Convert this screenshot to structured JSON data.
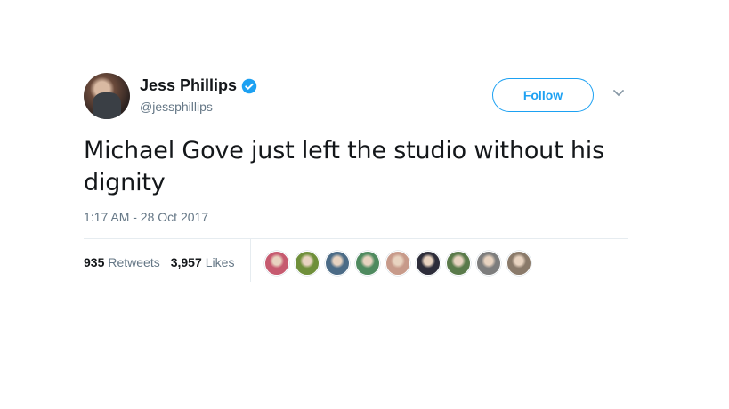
{
  "author": {
    "name": "Jess Phillips",
    "handle": "@jessphillips",
    "verified": true,
    "verified_color": "#1da1f2"
  },
  "follow_label": "Follow",
  "menu_icon": "chevron-down-icon",
  "tweet_text": "Michael Gove just left the studio without his dignity",
  "timestamp": "1:17 AM - 28 Oct 2017",
  "stats": {
    "retweets_count": "935",
    "retweets_label": "Retweets",
    "likes_count": "3,957",
    "likes_label": "Likes"
  },
  "likers": [
    {
      "color": "#c65a6f"
    },
    {
      "color": "#6f8f3a"
    },
    {
      "color": "#4b6b86"
    },
    {
      "color": "#4f8a5f"
    },
    {
      "color": "#c79a8a"
    },
    {
      "color": "#2d2d3a"
    },
    {
      "color": "#5a7a4a"
    },
    {
      "color": "#7d7d7d"
    },
    {
      "color": "#8a7a6a"
    }
  ],
  "colors": {
    "accent": "#1da1f2",
    "text": "#14171a",
    "muted": "#657786"
  }
}
